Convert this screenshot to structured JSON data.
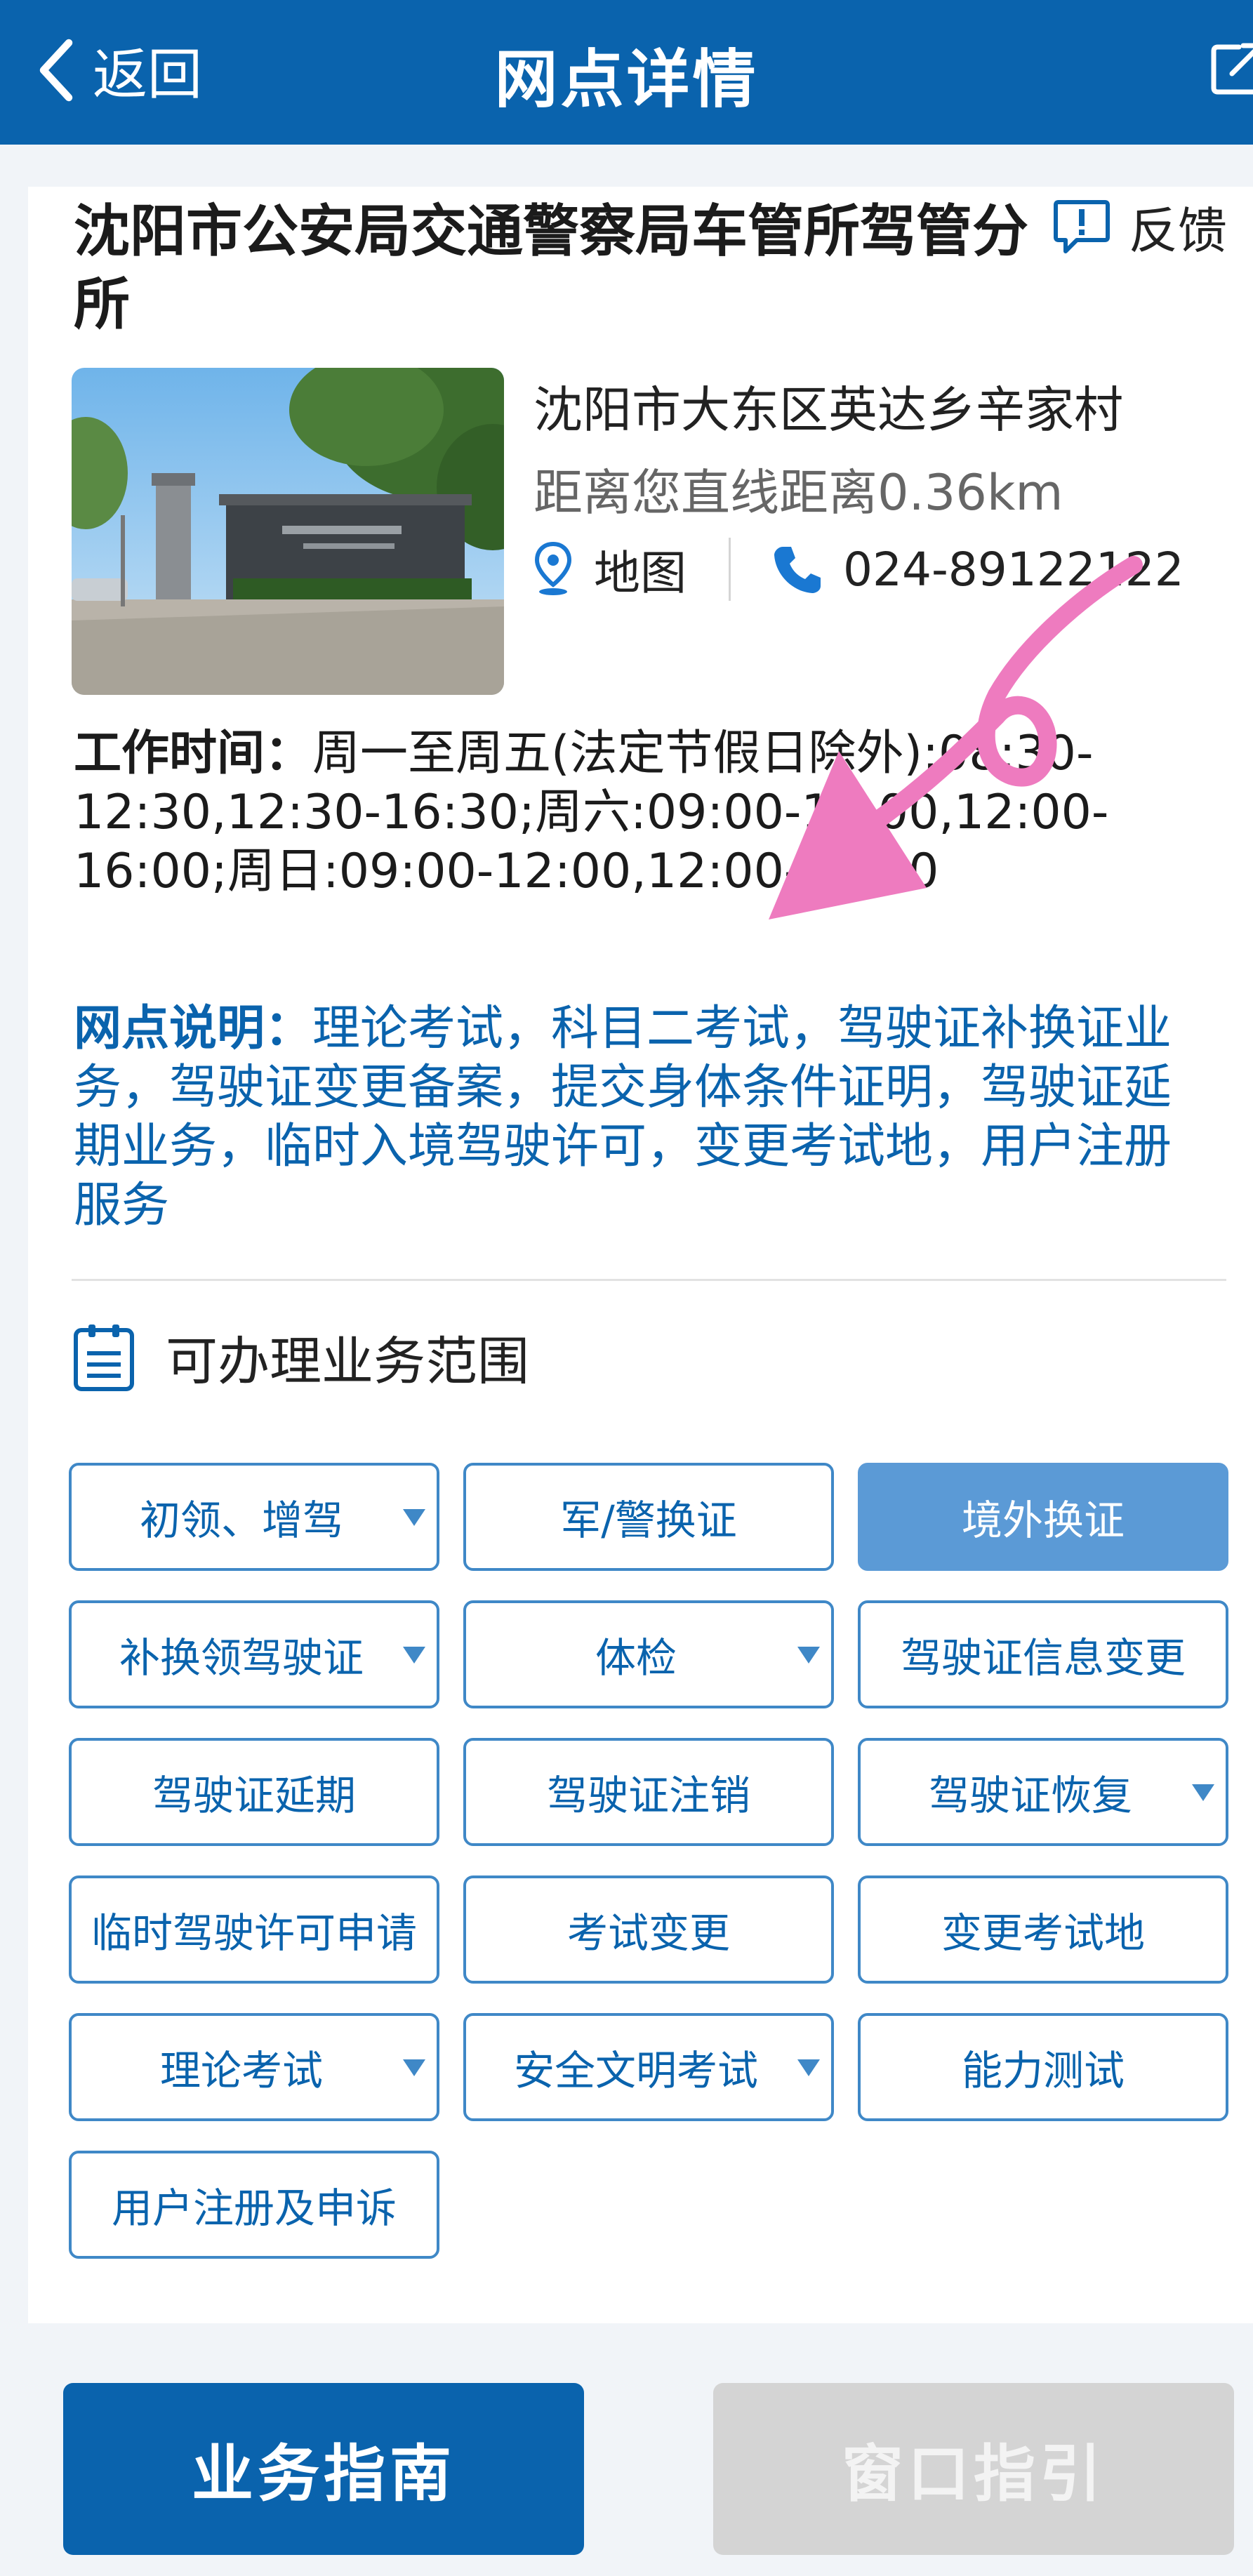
{
  "header": {
    "back_label": "返回",
    "title": "网点详情",
    "share_icon": "share-icon"
  },
  "office": {
    "name": "沈阳市公安局交通警察局车管所驾管分所",
    "feedback_label": "反馈",
    "address": "沈阳市大东区英达乡辛家村",
    "distance": "距离您直线距离0.36km",
    "map_label": "地图",
    "phone": "024-89122122"
  },
  "hours": {
    "label": "工作时间：",
    "value": "周一至周五(法定节假日除外):08:30-12:30,12:30-16:30;周六:09:00-12:00,12:00-16:00;周日:09:00-12:00,12:00-16:00"
  },
  "description": {
    "label": "网点说明：",
    "value": "理论考试，科目二考试，驾驶证补换证业务，驾驶证变更备案，提交身体条件证明，驾驶证延期业务，临时入境驾驶许可，变更考试地，用户注册服务"
  },
  "scope": {
    "title": "可办理业务范围",
    "buttons": [
      {
        "label": "初领、增驾",
        "dropdown": true
      },
      {
        "label": "军/警换证",
        "dropdown": false
      },
      {
        "label": "境外换证",
        "dropdown": false,
        "selected": true
      },
      {
        "label": "补换领驾驶证",
        "dropdown": true
      },
      {
        "label": "体检",
        "dropdown": true
      },
      {
        "label": "驾驶证信息变更",
        "dropdown": false
      },
      {
        "label": "驾驶证延期",
        "dropdown": false
      },
      {
        "label": "驾驶证注销",
        "dropdown": false
      },
      {
        "label": "驾驶证恢复",
        "dropdown": true
      },
      {
        "label": "临时驾驶许可申请",
        "dropdown": false
      },
      {
        "label": "考试变更",
        "dropdown": false
      },
      {
        "label": "变更考试地",
        "dropdown": false
      },
      {
        "label": "理论考试",
        "dropdown": true
      },
      {
        "label": "安全文明考试",
        "dropdown": true
      },
      {
        "label": "能力测试",
        "dropdown": false
      },
      {
        "label": "用户注册及申诉",
        "dropdown": false
      }
    ]
  },
  "bottom": {
    "guide_label": "业务指南",
    "window_label": "窗口指引"
  },
  "colors": {
    "brand": "#0a63ad",
    "selected": "#5b9ad6",
    "disabled": "#d4d4d4",
    "annotation": "#ee7bbf"
  }
}
